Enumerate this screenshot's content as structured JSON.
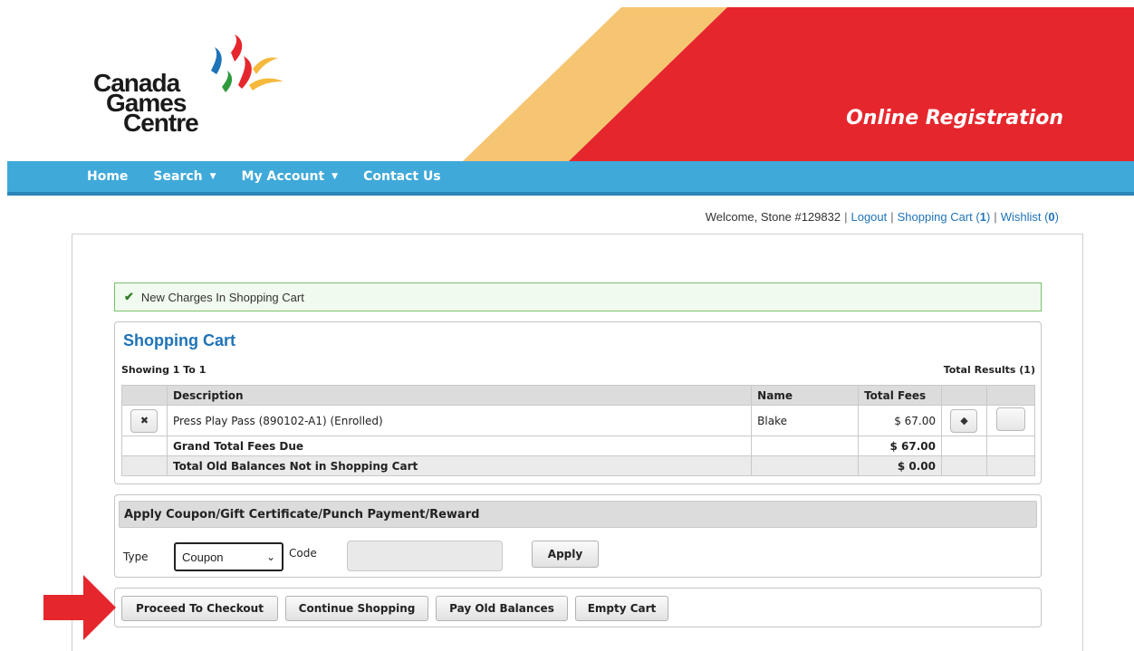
{
  "header": {
    "logo_line1": "Canada",
    "logo_line2": "Games",
    "logo_line3": "Centre",
    "banner_title": "Online Registration",
    "colors": {
      "red": "#e5272d",
      "orange": "#f6c572",
      "nav": "#3fa9d9"
    }
  },
  "nav": {
    "home": "Home",
    "search": "Search",
    "my_account": "My Account",
    "contact": "Contact Us"
  },
  "welcome": {
    "text": "Welcome, Stone #129832",
    "logout": "Logout",
    "cart_label": "Shopping Cart",
    "cart_count": "1",
    "wishlist_label": "Wishlist",
    "wishlist_count": "0"
  },
  "notice": {
    "text": "New Charges In Shopping Cart"
  },
  "cart": {
    "title": "Shopping Cart",
    "showing": "Showing 1 To 1",
    "total_results": "Total Results (1)",
    "headers": {
      "description": "Description",
      "name": "Name",
      "total_fees": "Total Fees"
    },
    "item": {
      "description": "Press Play Pass (890102-A1) (Enrolled)",
      "name": "Blake",
      "fee": "$ 67.00"
    },
    "grand_total_label": "Grand Total Fees Due",
    "grand_total_value": "$ 67.00",
    "old_balances_label": "Total Old Balances Not in Shopping Cart",
    "old_balances_value": "$ 0.00"
  },
  "coupon": {
    "heading": "Apply Coupon/Gift Certificate/Punch Payment/Reward",
    "type_label": "Type",
    "type_value": "Coupon",
    "code_label": "Code",
    "code_value": "",
    "apply": "Apply"
  },
  "actions": {
    "checkout": "Proceed To Checkout",
    "continue": "Continue Shopping",
    "pay_old": "Pay Old Balances",
    "empty": "Empty Cart"
  }
}
